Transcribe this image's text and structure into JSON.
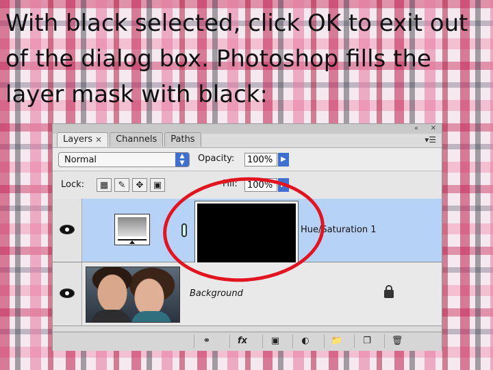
{
  "caption": "With black selected, click OK to exit out of the dialog box. Photoshop fills the layer mask with black:",
  "panel": {
    "tabs": [
      {
        "label": "Layers",
        "close": "✕"
      },
      {
        "label": "Channels"
      },
      {
        "label": "Paths"
      }
    ],
    "blend_mode": "Normal",
    "opacity_label": "Opacity:",
    "opacity_value": "100%",
    "lock_label": "Lock:",
    "fill_label": "Fill:",
    "fill_value": "100%",
    "layers": [
      {
        "name": "Hue/Saturation 1",
        "selected": true
      },
      {
        "name": "Background",
        "locked": true
      }
    ],
    "bottom_icons": [
      "link-icon",
      "fx-icon",
      "mask-icon",
      "adjustment-icon",
      "folder-icon",
      "new-layer-icon",
      "trash-icon"
    ],
    "fx_label": "fx"
  },
  "colors": {
    "selection": "#b7d2f7",
    "annotation_circle": "#e2141f",
    "accent": "#3f6fd0"
  }
}
